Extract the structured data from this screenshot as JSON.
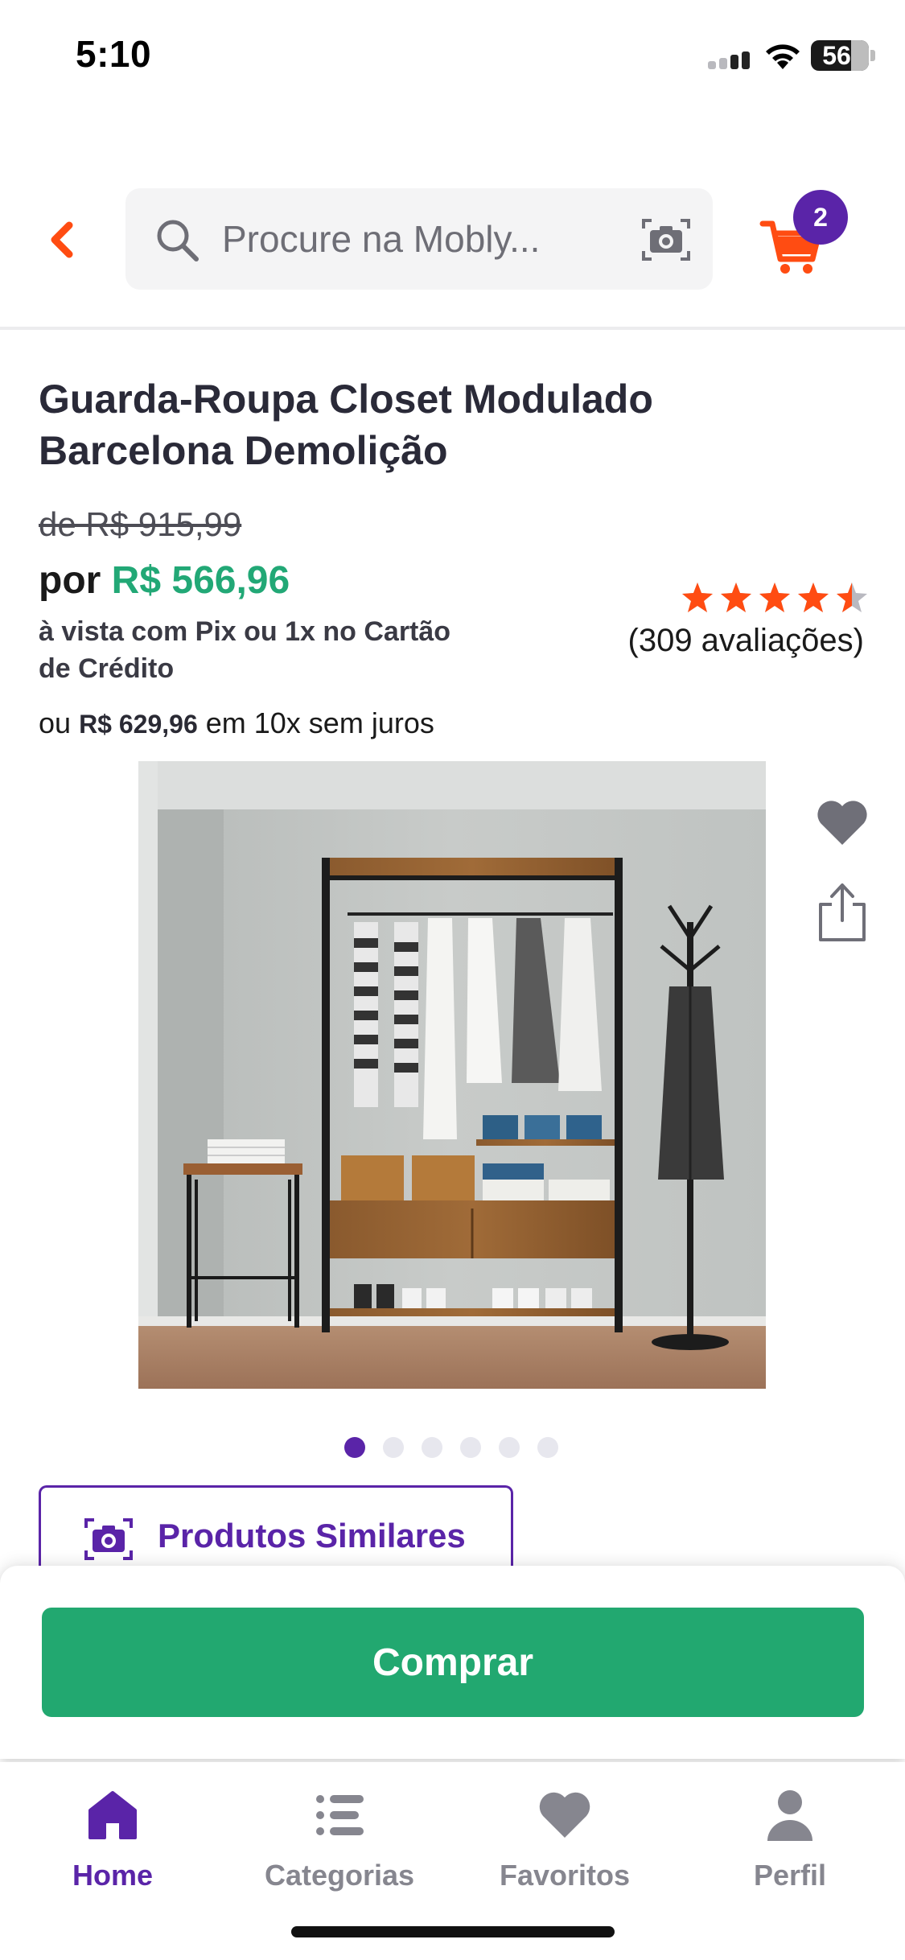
{
  "status_bar": {
    "time": "5:10",
    "battery": "56"
  },
  "header": {
    "search_placeholder": "Procure na Mobly...",
    "cart_count": "2"
  },
  "product": {
    "title": "Guarda-Roupa Closet Modulado Barcelona Demolição",
    "old_price": "de R$ 915,99",
    "price_prefix": "por",
    "price": "R$ 566,96",
    "pix_note": "à vista com Pix ou 1x no Cartão de Crédito",
    "installments_prefix": "ou",
    "installments_price": "R$ 629,96",
    "installments_suffix": "em 10x sem juros",
    "rating_value": 4.5,
    "rating_max": 5,
    "reviews": "(309 avaliações)",
    "image_count": 6,
    "image_active_index": 0
  },
  "actions": {
    "similar_label": "Produtos Similares",
    "buy_label": "Comprar"
  },
  "bottom_nav": {
    "items": [
      {
        "label": "Home",
        "icon": "home-icon",
        "active": true
      },
      {
        "label": "Categorias",
        "icon": "list-icon",
        "active": false
      },
      {
        "label": "Favoritos",
        "icon": "heart-icon",
        "active": false
      },
      {
        "label": "Perfil",
        "icon": "user-icon",
        "active": false
      }
    ]
  },
  "colors": {
    "accent_purple": "#5a24a8",
    "price_green": "#22a876",
    "buy_green": "#22a870",
    "orange": "#ff4c12"
  }
}
